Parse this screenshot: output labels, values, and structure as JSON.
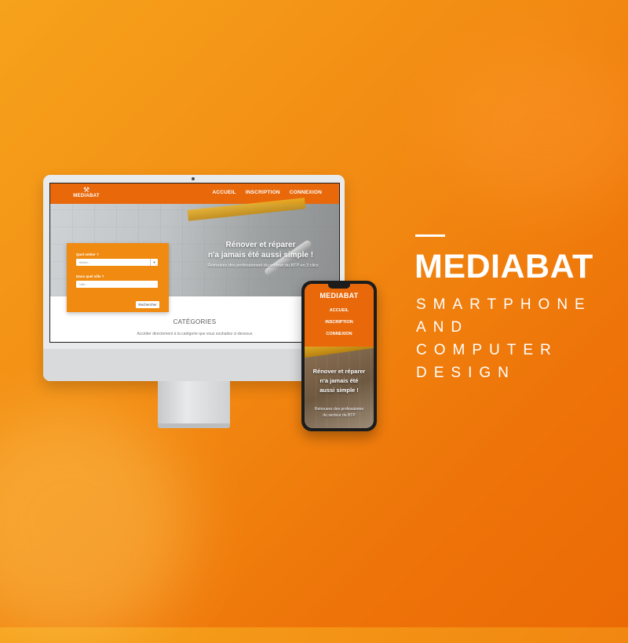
{
  "colors": {
    "brand_orange": "#e8680a",
    "background_orange": "#f28a12",
    "text_white": "#ffffff"
  },
  "branding": {
    "title": "MEDIABAT",
    "tagline_lines": [
      "SMARTPHONE",
      "AND",
      "COMPUTER",
      "DESIGN"
    ]
  },
  "desktop": {
    "logo_text": "MEDIABAT",
    "logo_icon": "crossed-hammers-icon",
    "nav": [
      "ACCUEIL",
      "INSCRIPTION",
      "CONNEXION"
    ],
    "hero_title_line1": "Rénover et réparer",
    "hero_title_line2": "n'a jamais été aussi simple !",
    "hero_subtitle": "Retrouvez des professionnel du secteur du BTP en 3 clics",
    "search_form": {
      "what_label": "Quel métier ?",
      "what_placeholder": "Métier...",
      "where_label": "Dans quel ville ?",
      "where_placeholder": "Ville...",
      "submit_label": "Rechercher"
    },
    "categories_title": "CATÉGORIES",
    "categories_subtitle": "Accéder directement à la catégorie que vous souhaitez ci-dessous"
  },
  "phone": {
    "brand": "MEDIABAT",
    "menu": [
      "ACCUEIL",
      "INSCRIPTION",
      "CONNEXION"
    ],
    "hero_title_lines": [
      "Rénover et réparer",
      "n'a jamais été",
      "aussi simple !"
    ],
    "hero_subtitle_lines": [
      "Retrouvez des professionne",
      "du secteur du BTP"
    ]
  }
}
